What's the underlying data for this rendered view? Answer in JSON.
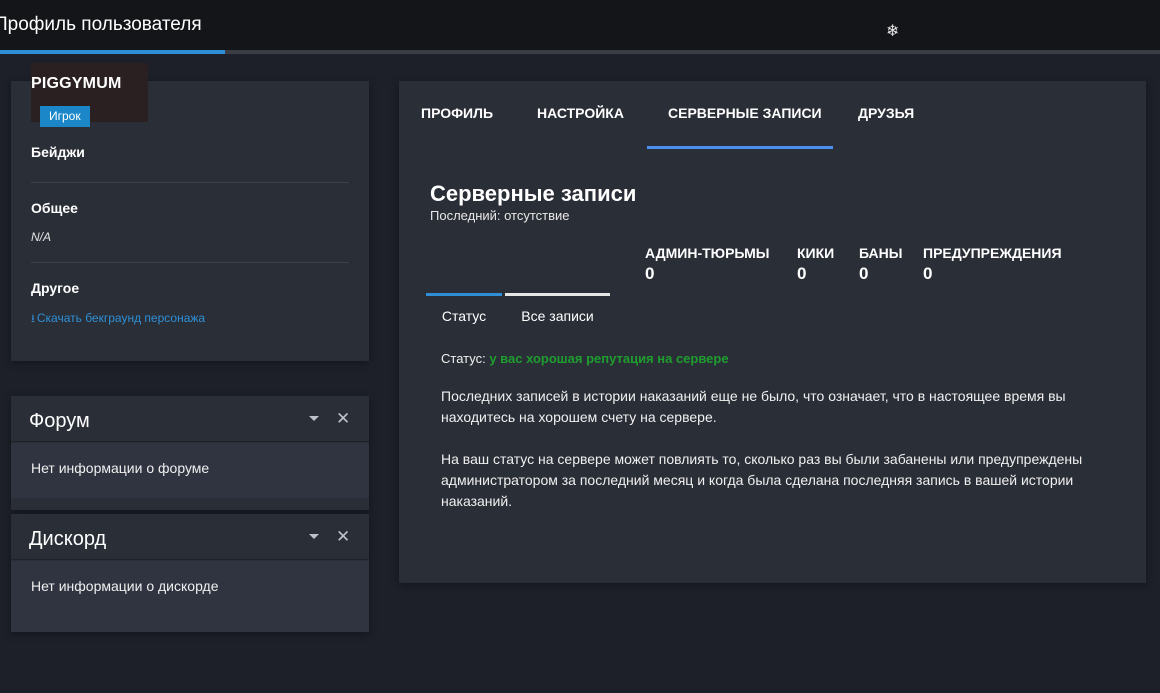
{
  "window": {
    "title": "Профиль пользователя",
    "progress_fraction": 0.194
  },
  "profile": {
    "username": "PIGGYMUM",
    "role": "Игрок",
    "badges_label": "Бейджи",
    "general_label": "Общее",
    "general_value": "N/A",
    "other_label": "Другое",
    "download_link": "Скачать бекграунд персонажа"
  },
  "forum": {
    "title": "Форум",
    "body": "Нет информации о форуме"
  },
  "discord": {
    "title": "Дискорд",
    "body": "Нет информации о дискорде"
  },
  "tabs": [
    {
      "label": "ПРОФИЛЬ",
      "active": false
    },
    {
      "label": "НАСТРОЙКА",
      "active": false
    },
    {
      "label": "СЕРВЕРНЫЕ ЗАПИСИ",
      "active": true
    },
    {
      "label": "ДРУЗЬЯ",
      "active": false
    }
  ],
  "records": {
    "title": "Серверные записи",
    "last": "Последний: отсутствие",
    "stats": [
      {
        "label": "АДМИН-ТЮРЬМЫ",
        "value": "0"
      },
      {
        "label": "КИКИ",
        "value": "0"
      },
      {
        "label": "БАНЫ",
        "value": "0"
      },
      {
        "label": "ПРЕДУПРЕЖДЕНИЯ",
        "value": "0"
      }
    ],
    "subtabs": [
      {
        "label": "Статус",
        "active": true
      },
      {
        "label": "Все записи",
        "active": false
      }
    ],
    "status_label": "Статус:",
    "status_value": "у вас хорошая репутация на сервере",
    "paragraph1": "Последних записей в истории наказаний еще не было, что означает, что в настоящее время вы находитесь на хорошем счету на сервере.",
    "paragraph2": "На ваш статус на сервере может повлиять то, сколько раз вы были забанены или предупреждены администратором за последний месяц и когда была сделана последняя запись в вашей истории наказаний."
  },
  "colors": {
    "accent": "#2f8fd6",
    "tab_underline": "#4a8ff0",
    "good_status": "#1f9d2f",
    "background": "#1d2029",
    "card": "#2a2e37"
  },
  "icons": {
    "topbar": "snowflake-icon",
    "download": "download-icon",
    "collapse": "caret-down-icon",
    "close": "close-icon"
  }
}
